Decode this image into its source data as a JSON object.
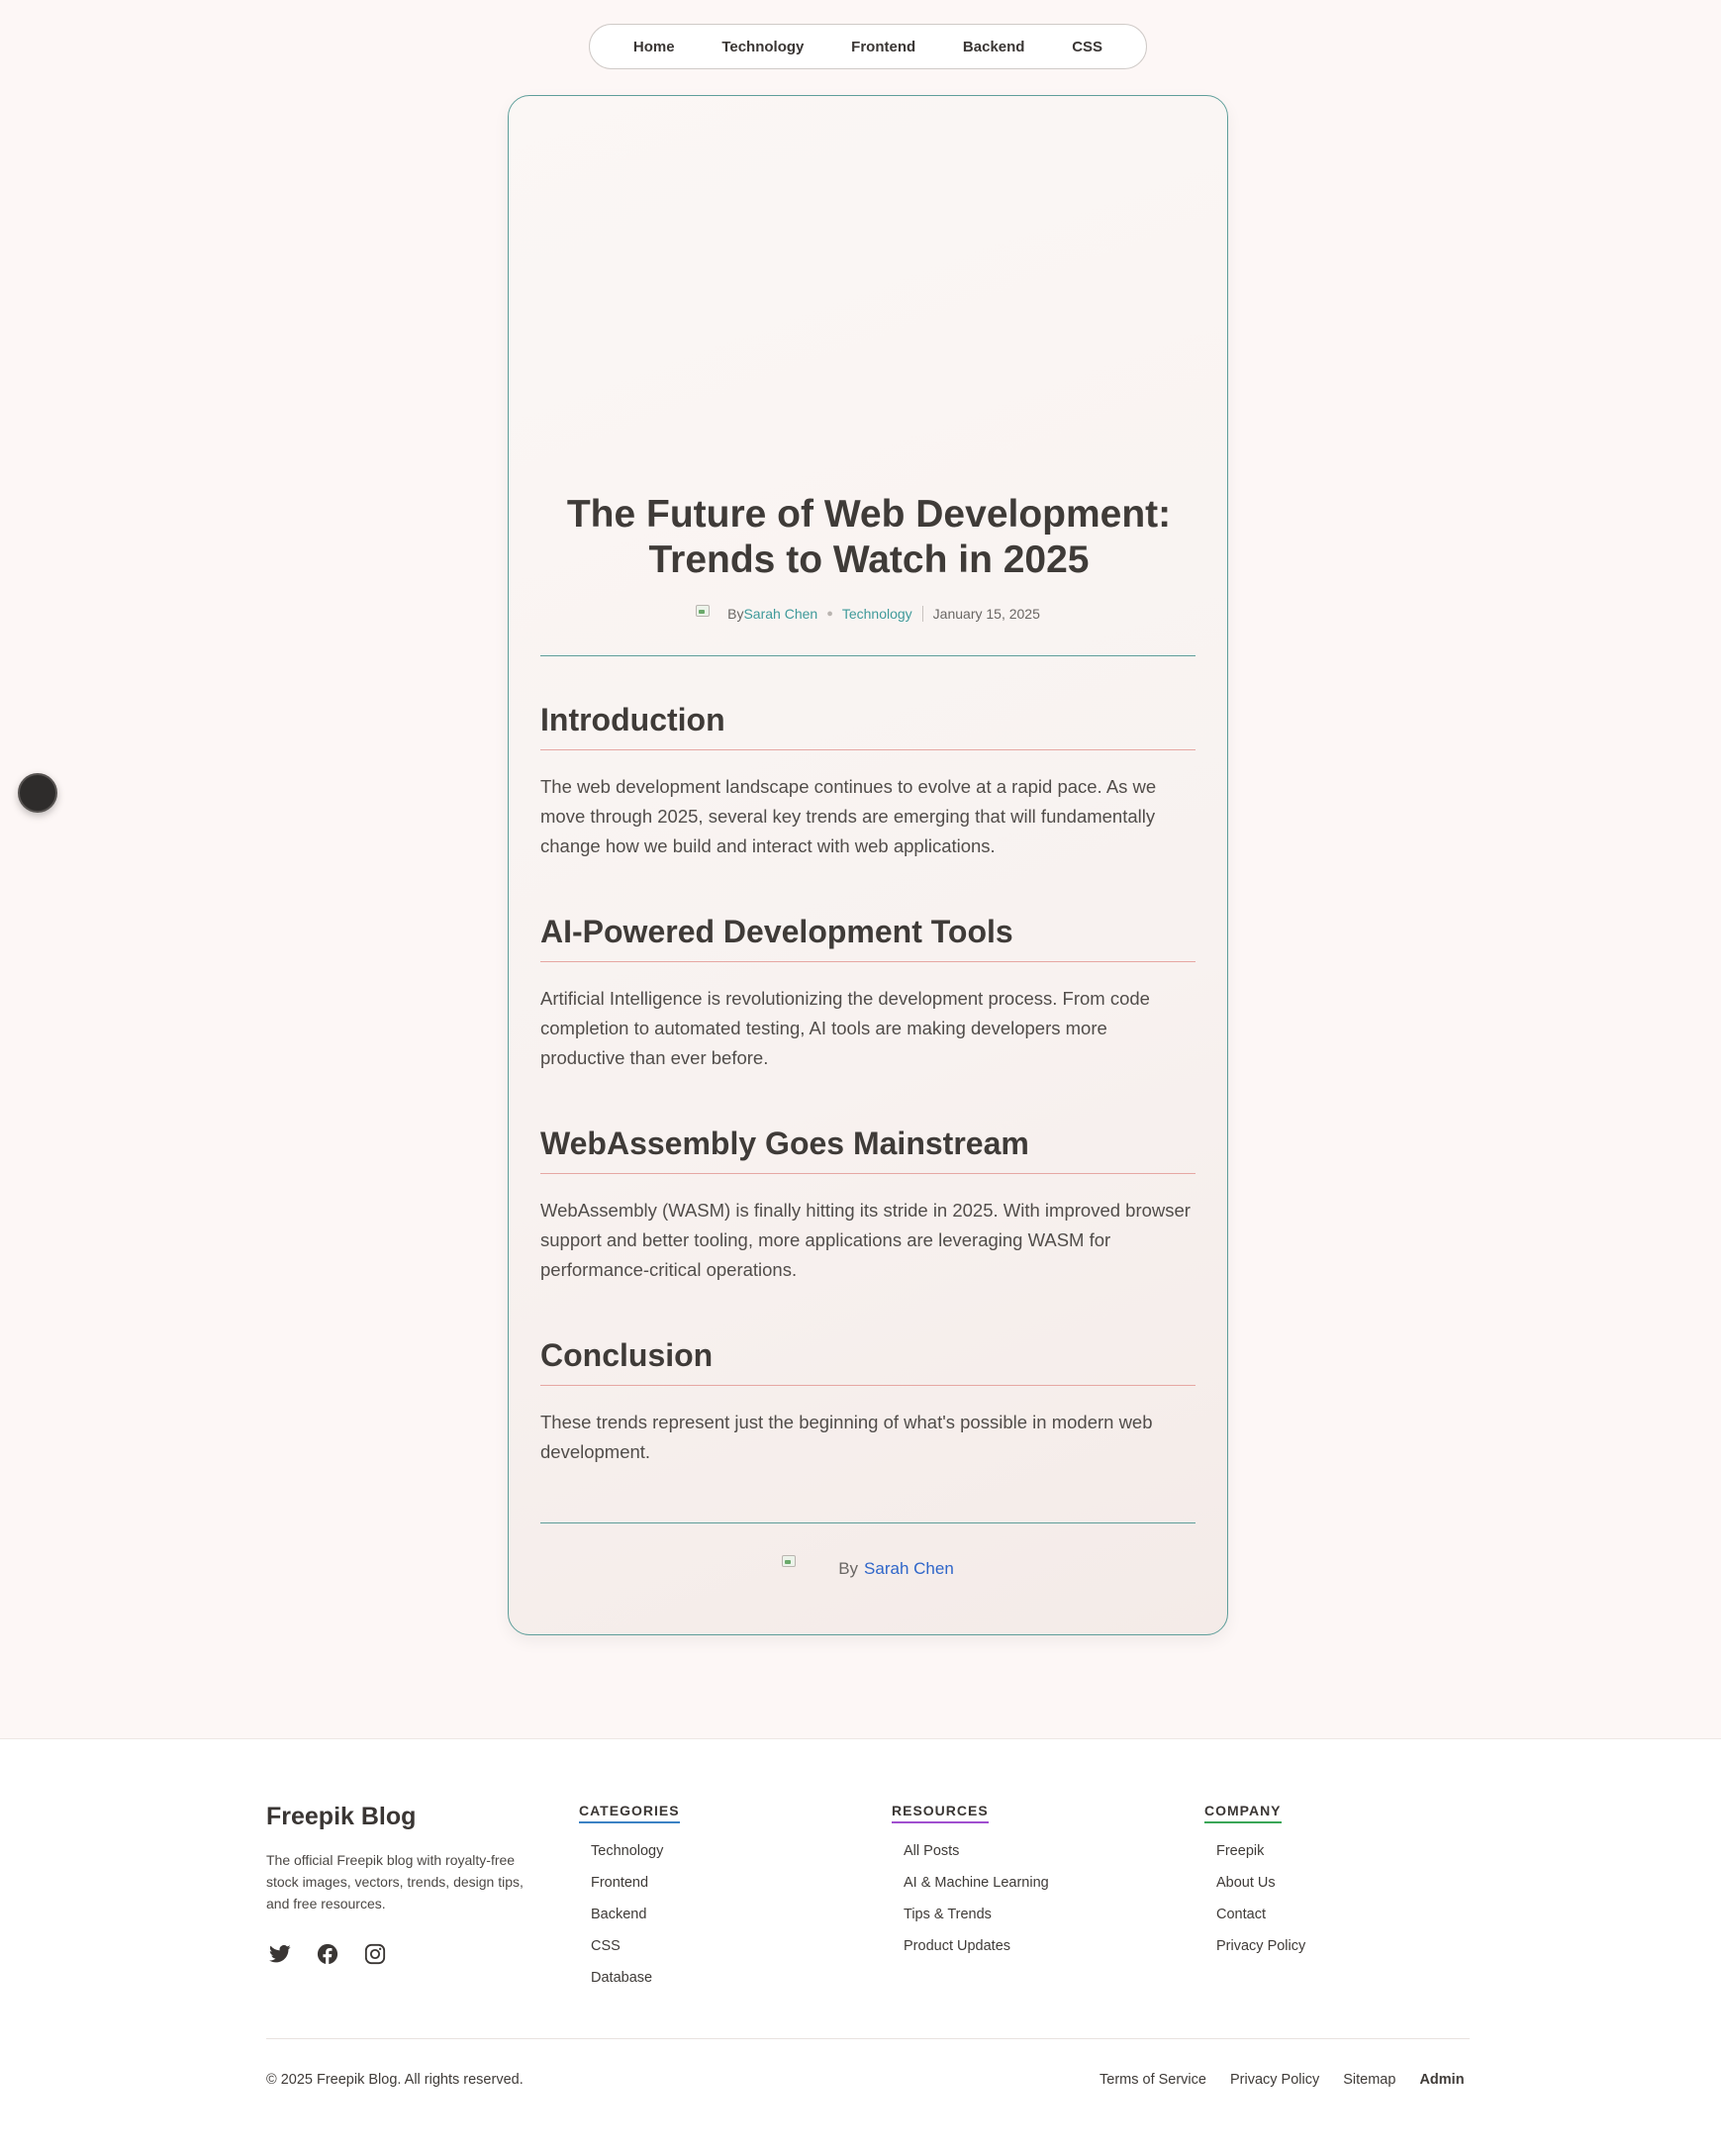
{
  "nav": {
    "items": [
      "Home",
      "Technology",
      "Frontend",
      "Backend",
      "CSS"
    ]
  },
  "article": {
    "title": "The Future of Web Development: Trends to Watch in 2025",
    "meta": {
      "by": "By",
      "author": "Sarah Chen",
      "category": "Technology",
      "date": "January 15, 2025"
    },
    "sections": [
      {
        "heading": "Introduction",
        "body": "The web development landscape continues to evolve at a rapid pace. As we move through 2025, several key trends are emerging that will fundamentally change how we build and interact with web applications."
      },
      {
        "heading": "AI-Powered Development Tools",
        "body": "Artificial Intelligence is revolutionizing the development process. From code completion to automated testing, AI tools are making developers more productive than ever before."
      },
      {
        "heading": "WebAssembly Goes Mainstream",
        "body": "WebAssembly (WASM) is finally hitting its stride in 2025. With improved browser support and better tooling, more applications are leveraging WASM for performance-critical operations."
      },
      {
        "heading": "Conclusion",
        "body": "These trends represent just the beginning of what's possible in modern web development."
      }
    ],
    "byline": {
      "by": "By",
      "author": "Sarah Chen"
    }
  },
  "footer": {
    "brand": {
      "title": "Freepik Blog",
      "description": "The official Freepik blog with royalty-free stock images, vectors, trends, design tips, and free resources."
    },
    "social_icons": [
      "twitter-icon",
      "facebook-icon",
      "instagram-icon"
    ],
    "columns": [
      {
        "heading": "CATEGORIES",
        "accent": "#3b82c4",
        "links": [
          "Technology",
          "Frontend",
          "Backend",
          "CSS",
          "Database"
        ]
      },
      {
        "heading": "RESOURCES",
        "accent": "#a04fcf",
        "links": [
          "All Posts",
          "AI & Machine Learning",
          "Tips & Trends",
          "Product Updates"
        ]
      },
      {
        "heading": "COMPANY",
        "accent": "#3aa657",
        "links": [
          "Freepik",
          "About Us",
          "Contact",
          "Privacy Policy"
        ]
      }
    ],
    "copyright": "© 2025 Freepik Blog. All rights reserved.",
    "legal_links": [
      "Terms of Service",
      "Privacy Policy",
      "Sitemap",
      "Admin"
    ]
  },
  "colors": {
    "background": "#fdf7f6",
    "card_border": "#5e9e9a",
    "heading_rule": "#e6a7a3",
    "link_teal": "#3f9a9a",
    "link_blue": "#2f66c9"
  }
}
